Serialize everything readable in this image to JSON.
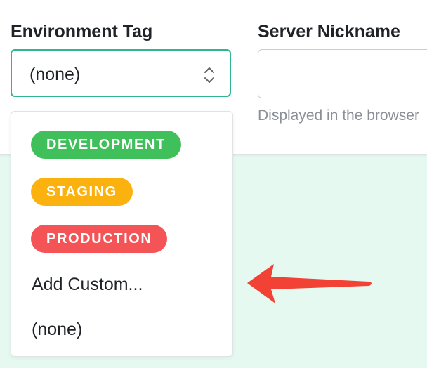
{
  "environment_tag": {
    "label": "Environment Tag",
    "selected_value": "(none)",
    "options": [
      {
        "label": "DEVELOPMENT",
        "color": "#3fc05a"
      },
      {
        "label": "STAGING",
        "color": "#fbb20f"
      },
      {
        "label": "PRODUCTION",
        "color": "#f55456"
      },
      {
        "label": "Add Custom..."
      },
      {
        "label": "(none)"
      }
    ]
  },
  "server_nickname": {
    "label": "Server Nickname",
    "value": "",
    "helper_text": "Displayed in the browser"
  },
  "colors": {
    "focus_border": "#30b58e",
    "background": "#e6f9f1",
    "annotation_arrow": "#f24236"
  },
  "icons": {
    "select_chevrons": "chevron-up-down-icon",
    "annotation": "red-arrow-left-icon"
  }
}
